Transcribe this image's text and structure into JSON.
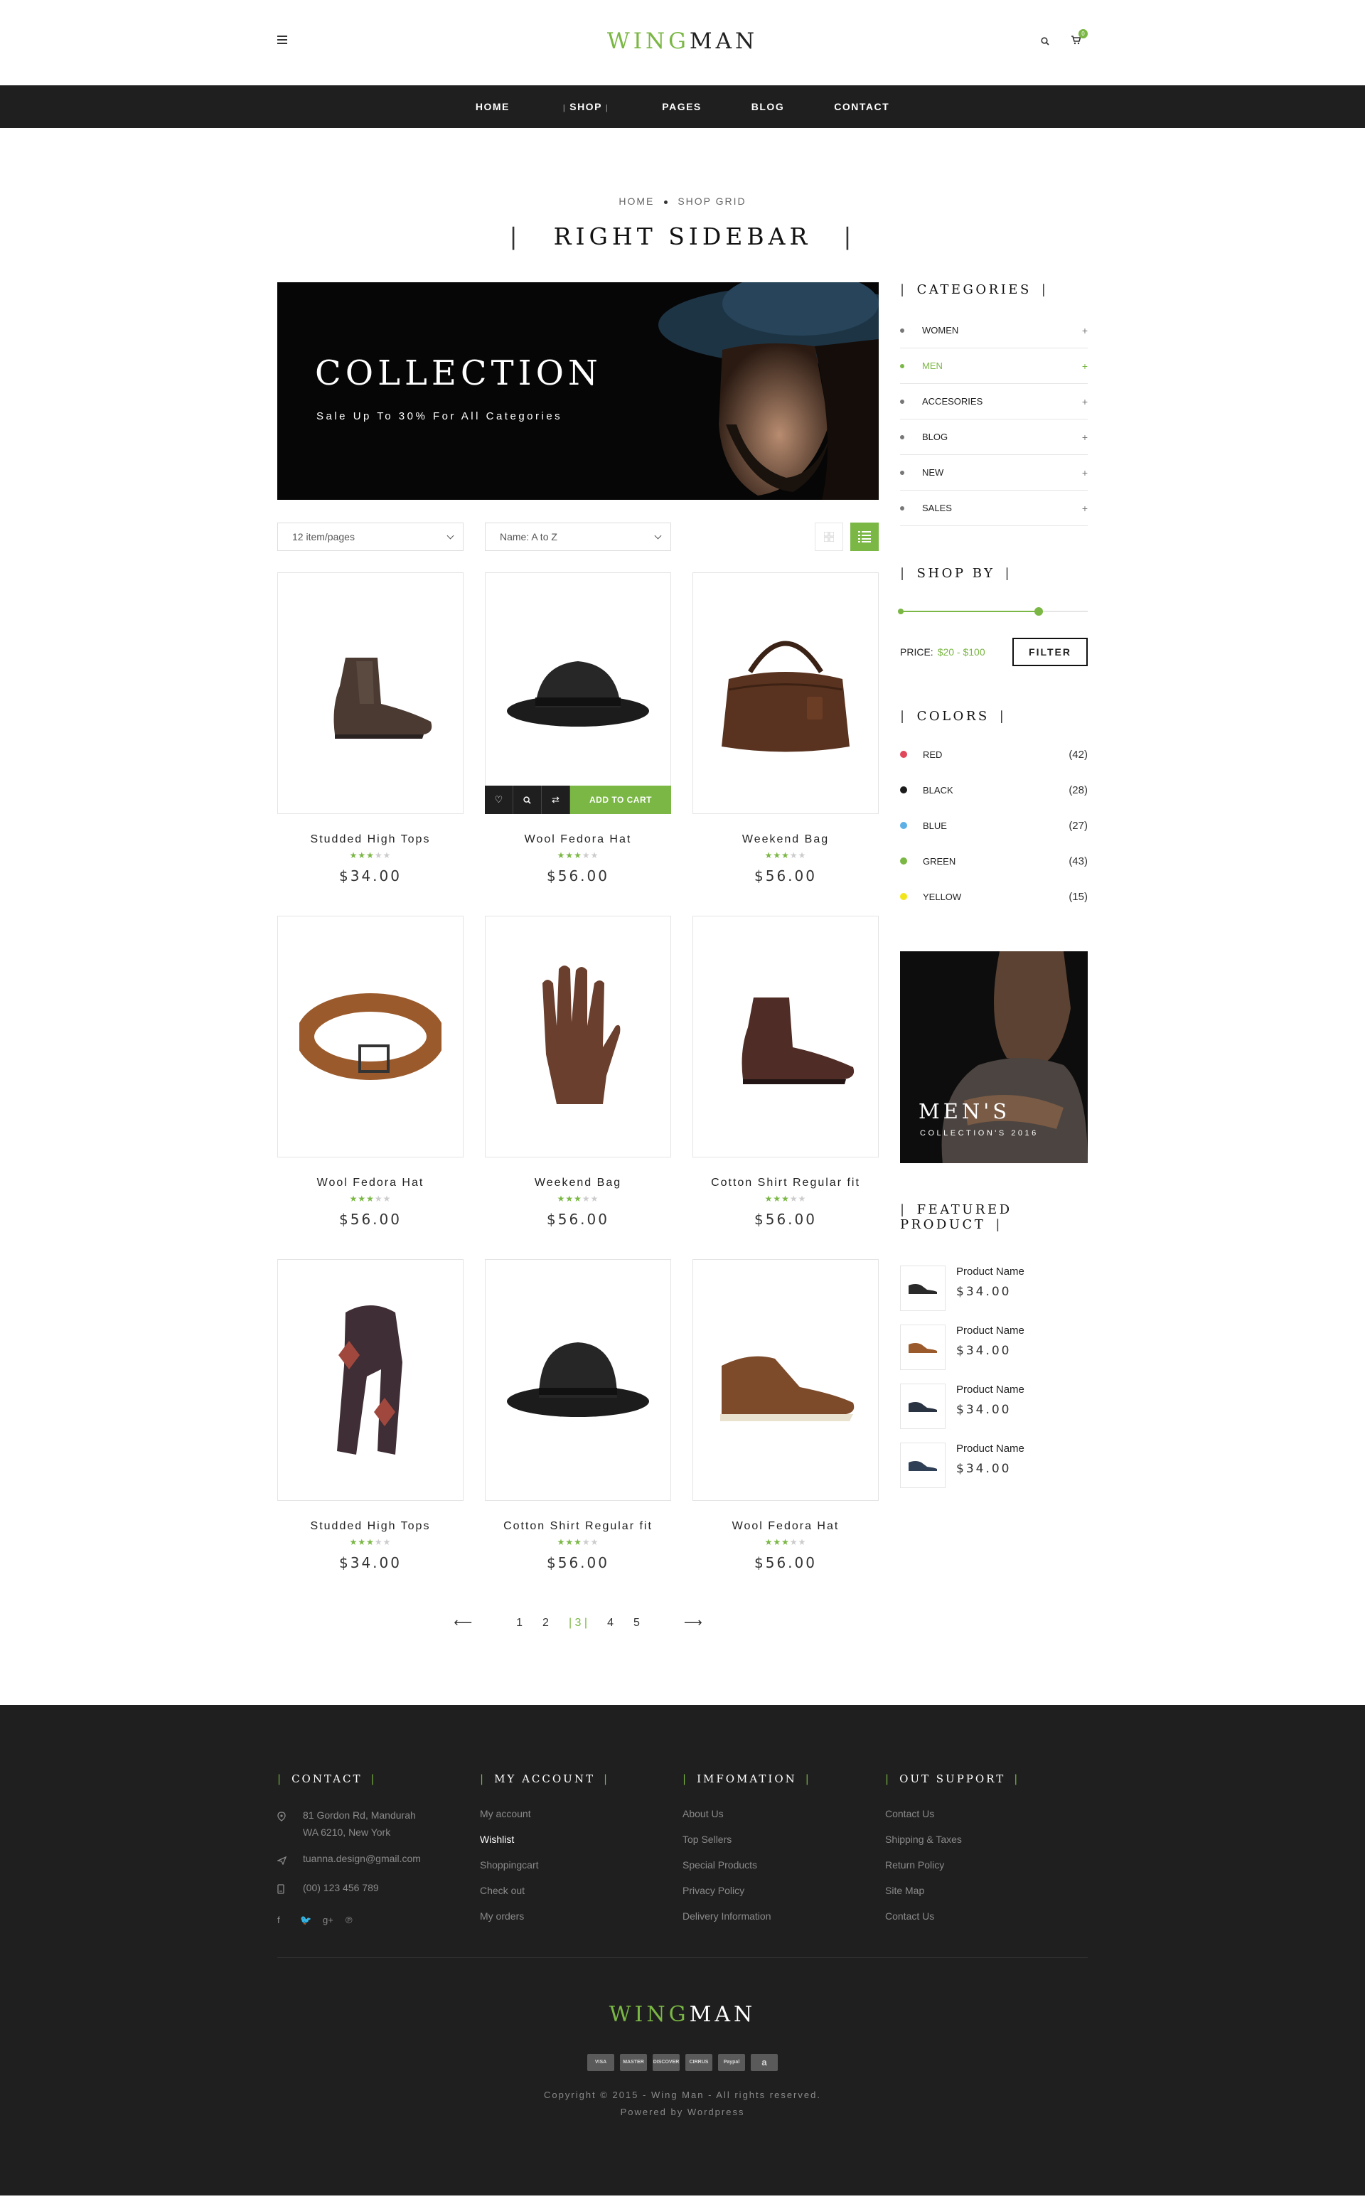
{
  "header": {
    "logo_part1": "WING",
    "logo_part2": "MAN",
    "cart_count": "0"
  },
  "nav": {
    "items": [
      "HOME",
      "SHOP",
      "PAGES",
      "BLOG",
      "CONTACT"
    ],
    "active": "SHOP"
  },
  "breadcrumb": {
    "home": "HOME",
    "current": "SHOP GRID"
  },
  "page_title": "RIGHT SIDEBAR",
  "banner": {
    "title": "COLLECTION",
    "subtitle": "Sale Up To 30% For All Categories"
  },
  "toolbar": {
    "per_page": "12 item/pages",
    "sort": "Name: A to Z"
  },
  "products": [
    {
      "name": "Studded High Tops",
      "price": "$34.00",
      "rating": 3,
      "icon": "boot-icon"
    },
    {
      "name": "Wool Fedora Hat",
      "price": "$56.00",
      "rating": 3,
      "icon": "fedora-hat-icon"
    },
    {
      "name": "Weekend Bag",
      "price": "$56.00",
      "rating": 3,
      "icon": "leather-bag-icon"
    },
    {
      "name": "Wool Fedora Hat",
      "price": "$56.00",
      "rating": 3,
      "icon": "belt-icon"
    },
    {
      "name": "Weekend Bag",
      "price": "$56.00",
      "rating": 3,
      "icon": "glove-icon"
    },
    {
      "name": "Cotton Shirt Regular fit",
      "price": "$56.00",
      "rating": 3,
      "icon": "boot-icon"
    },
    {
      "name": "Studded High Tops",
      "price": "$34.00",
      "rating": 3,
      "icon": "scarf-icon"
    },
    {
      "name": "Cotton Shirt Regular fit",
      "price": "$56.00",
      "rating": 3,
      "icon": "hat-icon"
    },
    {
      "name": "Wool Fedora Hat",
      "price": "$56.00",
      "rating": 3,
      "icon": "sneaker-icon"
    }
  ],
  "product_actions": {
    "add_to_cart": "ADD TO CART"
  },
  "pagination": {
    "pages": [
      "1",
      "2",
      "3",
      "4",
      "5"
    ],
    "current": "3"
  },
  "sidebar": {
    "categories_title": "CATEGORIES",
    "categories": [
      "WOMEN",
      "MEN",
      "ACCESORIES",
      "BLOG",
      "NEW",
      "SALES"
    ],
    "active_category": "MEN",
    "shop_by_title": "SHOP BY",
    "price_label": "PRICE:",
    "price_range": "$20 - $100",
    "price_slider_fraction": 0.74,
    "filter_label": "FILTER",
    "colors_title": "COLORS",
    "colors": [
      {
        "name": "RED",
        "count": "(42)",
        "hex": "#e0475a"
      },
      {
        "name": "BLACK",
        "count": "(28)",
        "hex": "#1b1b1b"
      },
      {
        "name": "BLUE",
        "count": "(27)",
        "hex": "#5db0e6"
      },
      {
        "name": "GREEN",
        "count": "(43)",
        "hex": "#7ab744"
      },
      {
        "name": "YELLOW",
        "count": "(15)",
        "hex": "#f2e51b"
      }
    ],
    "promo_title": "MEN'S",
    "promo_sub": "COLLECTION'S 2016",
    "featured_title": "FEATURED PRODUCT",
    "featured": [
      {
        "name": "Product Name",
        "price": "$34.00",
        "color": "#2a2a2a"
      },
      {
        "name": "Product Name",
        "price": "$34.00",
        "color": "#9b5a2b"
      },
      {
        "name": "Product Name",
        "price": "$34.00",
        "color": "#2a3342"
      },
      {
        "name": "Product Name",
        "price": "$34.00",
        "color": "#2f3f55"
      }
    ]
  },
  "footer": {
    "contact_title": "CONTACT",
    "address_line1": "81 Gordon Rd, Mandurah",
    "address_line2": "WA 6210, New York",
    "email": "tuanna.design@gmail.com",
    "phone": "(00) 123 456 789",
    "account_title": "MY ACCOUNT",
    "account_links": [
      "My account",
      "Wishlist",
      "Shoppingcart",
      "Check out",
      "My orders"
    ],
    "info_title": "IMFOMATION",
    "info_links": [
      "About Us",
      "Top Sellers",
      "Special Products",
      "Privacy Policy",
      "Delivery Information"
    ],
    "support_title": "OUT SUPPORT",
    "support_links": [
      "Contact Us",
      "Shipping & Taxes",
      "Return Policy",
      "Site Map",
      "Contact Us"
    ],
    "logo_part1": "WING",
    "logo_part2": "MAN",
    "payments": [
      "VISA",
      "MASTER",
      "DISCOVER",
      "CIRRUS",
      "Paypal",
      "a"
    ],
    "copyright": "Copyright © 2015 - Wing Man - All rights reserved.",
    "powered": "Powered by Wordpress"
  },
  "colors": {
    "accent": "#7ab744",
    "dark": "#1f1f1f"
  }
}
